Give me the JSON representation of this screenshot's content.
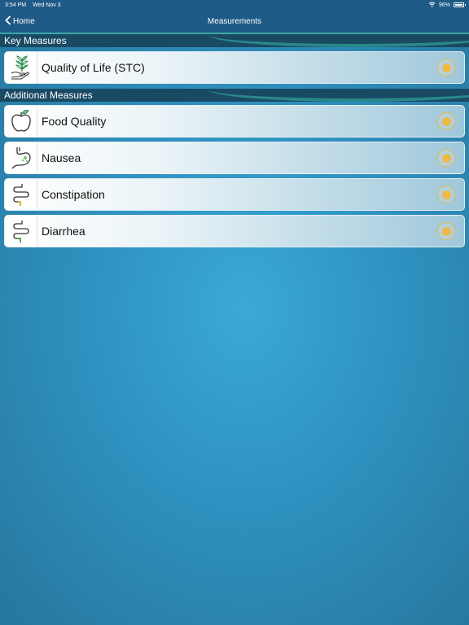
{
  "status_bar": {
    "time": "3:54 PM",
    "date": "Wed Nov 3",
    "battery": "96%"
  },
  "nav": {
    "back_label": "Home",
    "title": "Measurements"
  },
  "sections": [
    {
      "header": "Key Measures",
      "items": [
        {
          "label": "Quality of Life (STC)",
          "icon": "plant-hand-icon"
        }
      ]
    },
    {
      "header": "Additional Measures",
      "items": [
        {
          "label": "Food Quality",
          "icon": "apple-icon"
        },
        {
          "label": "Nausea",
          "icon": "stomach-icon"
        },
        {
          "label": "Constipation",
          "icon": "intestine-icon"
        },
        {
          "label": "Diarrhea",
          "icon": "intestine-icon"
        }
      ]
    }
  ],
  "colors": {
    "status_dot": "#f0b943",
    "header_bg": "#1a4a63",
    "nav_bg": "#1f5a86"
  }
}
